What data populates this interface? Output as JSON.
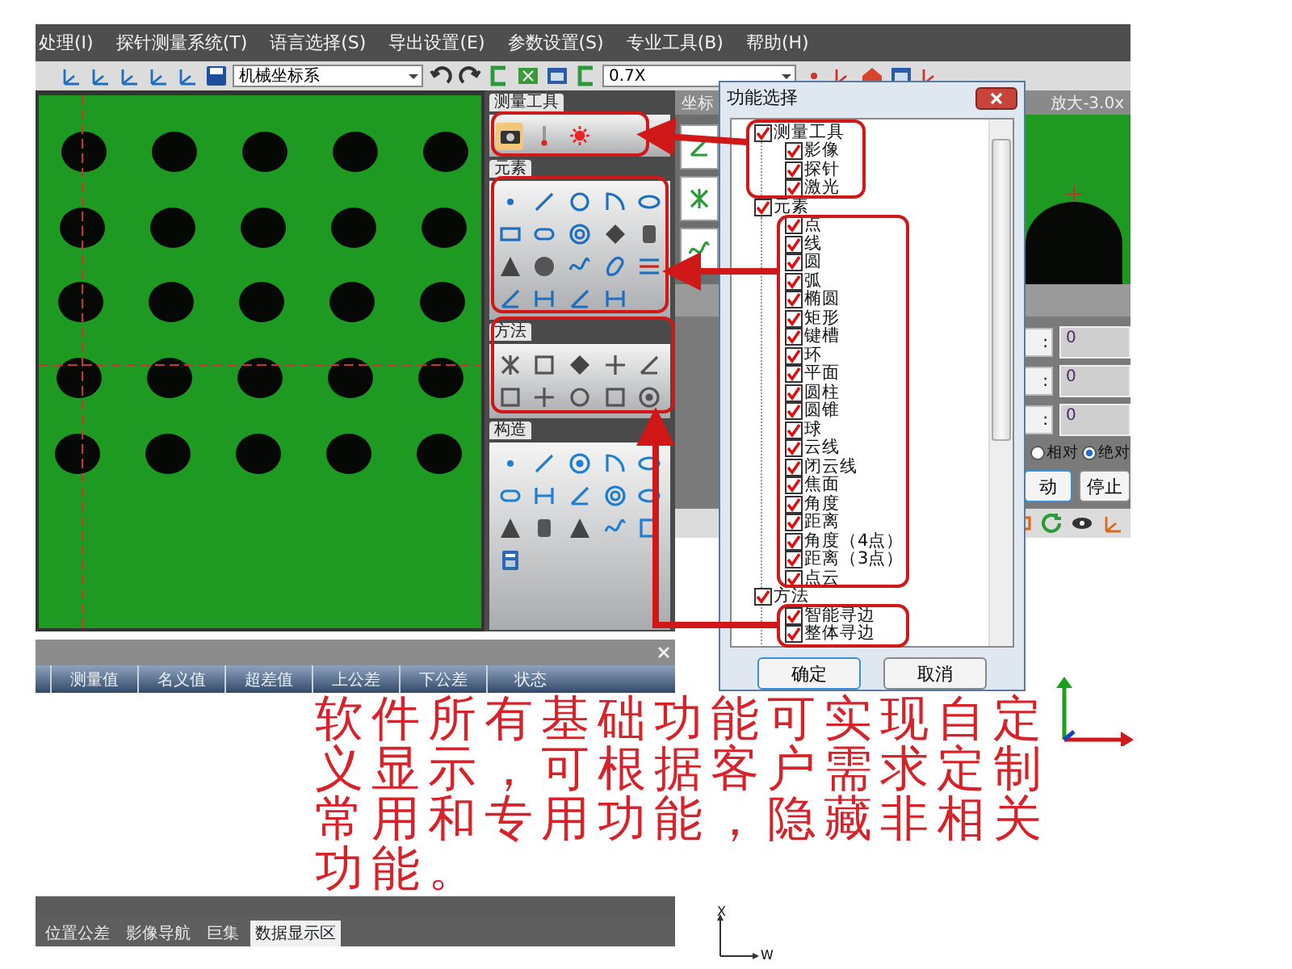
{
  "menu": [
    "处理(I)",
    "探针测量系统(T)",
    "语言选择(S)",
    "导出设置(E)",
    "参数设置(S)",
    "专业工具(B)",
    "帮助(H)"
  ],
  "toolbar": {
    "coordinate_system": "机械坐标系",
    "zoom": "0.7X"
  },
  "dock": {
    "sections": [
      {
        "title": "测量工具"
      },
      {
        "title": "元素"
      },
      {
        "title": "方法"
      },
      {
        "title": "构造"
      }
    ]
  },
  "view_panel": {
    "tab": "坐标",
    "magnification": "放大-3.0x"
  },
  "motion": {
    "fields": [
      {
        "label": ":",
        "value": "0"
      },
      {
        "label": ":",
        "value": "0"
      },
      {
        "label": ":",
        "value": "0"
      }
    ],
    "modes": [
      {
        "label": "相对",
        "selected": false
      },
      {
        "label": "绝对",
        "selected": true
      }
    ],
    "buttons": [
      "动",
      "停止"
    ]
  },
  "results": {
    "columns": [
      "测量值",
      "名义值",
      "超差值",
      "上公差",
      "下公差",
      "状态"
    ]
  },
  "bottom_tabs": [
    {
      "label": "位置公差",
      "selected": false
    },
    {
      "label": "影像导航",
      "selected": false
    },
    {
      "label": "巨集",
      "selected": false
    },
    {
      "label": "数据显示区",
      "selected": true
    }
  ],
  "dialog": {
    "title": "功能选择",
    "tree": [
      {
        "label": "测量工具",
        "checked": true,
        "expanded": true,
        "children": [
          {
            "label": "影像",
            "checked": true
          },
          {
            "label": "探针",
            "checked": true
          },
          {
            "label": "激光",
            "checked": true
          }
        ]
      },
      {
        "label": "元素",
        "checked": true,
        "expanded": true,
        "children": [
          {
            "label": "点",
            "checked": true
          },
          {
            "label": "线",
            "checked": true
          },
          {
            "label": "圆",
            "checked": true
          },
          {
            "label": "弧",
            "checked": true
          },
          {
            "label": "椭圆",
            "checked": true
          },
          {
            "label": "矩形",
            "checked": true
          },
          {
            "label": "键槽",
            "checked": true
          },
          {
            "label": "环",
            "checked": true
          },
          {
            "label": "平面",
            "checked": true
          },
          {
            "label": "圆柱",
            "checked": true
          },
          {
            "label": "圆锥",
            "checked": true
          },
          {
            "label": "球",
            "checked": true
          },
          {
            "label": "云线",
            "checked": true
          },
          {
            "label": "闭云线",
            "checked": true
          },
          {
            "label": "焦面",
            "checked": true
          },
          {
            "label": "角度",
            "checked": true
          },
          {
            "label": "距离",
            "checked": true
          },
          {
            "label": "角度（4点）",
            "checked": true
          },
          {
            "label": "距离（3点）",
            "checked": true
          },
          {
            "label": "点云",
            "checked": true
          }
        ]
      },
      {
        "label": "方法",
        "checked": true,
        "expanded": true,
        "children": [
          {
            "label": "智能寻边",
            "checked": true
          },
          {
            "label": "整体寻边",
            "checked": true
          }
        ]
      }
    ],
    "buttons": [
      "确定",
      "取消"
    ]
  },
  "annotation": "软件所有基础功能可实现自定义显示，可根据客户需求定制常用和专用功能，隐藏非相关功能。",
  "axis_labels": [
    "X",
    "W"
  ]
}
